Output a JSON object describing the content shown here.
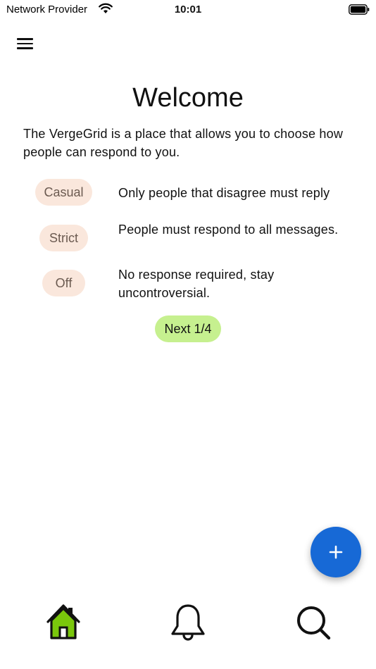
{
  "status_bar": {
    "carrier": "Network Provider",
    "time": "10:01",
    "wifi_icon": "wifi-icon",
    "battery_icon": "battery-icon"
  },
  "header": {
    "menu_icon": "hamburger-menu-icon"
  },
  "main": {
    "title": "Welcome",
    "intro": "The VergeGrid is a place that allows you to choose how people can respond to you.",
    "options": [
      {
        "label": "Casual",
        "description": "Only people that disagree must reply"
      },
      {
        "label": "Strict",
        "description": "People must respond to all messages."
      },
      {
        "label": "Off",
        "description": "No response required, stay uncontroversial."
      }
    ],
    "next_label": "Next 1/4"
  },
  "fab": {
    "icon": "plus-icon",
    "color": "#1769d6"
  },
  "bottom_nav": {
    "items": [
      {
        "icon": "home-icon",
        "active": true,
        "active_color": "#7ac70c"
      },
      {
        "icon": "bell-icon",
        "active": false
      },
      {
        "icon": "search-icon",
        "active": false
      }
    ]
  },
  "colors": {
    "pill_bg": "#fae7dc",
    "next_bg": "#c6f08f"
  }
}
